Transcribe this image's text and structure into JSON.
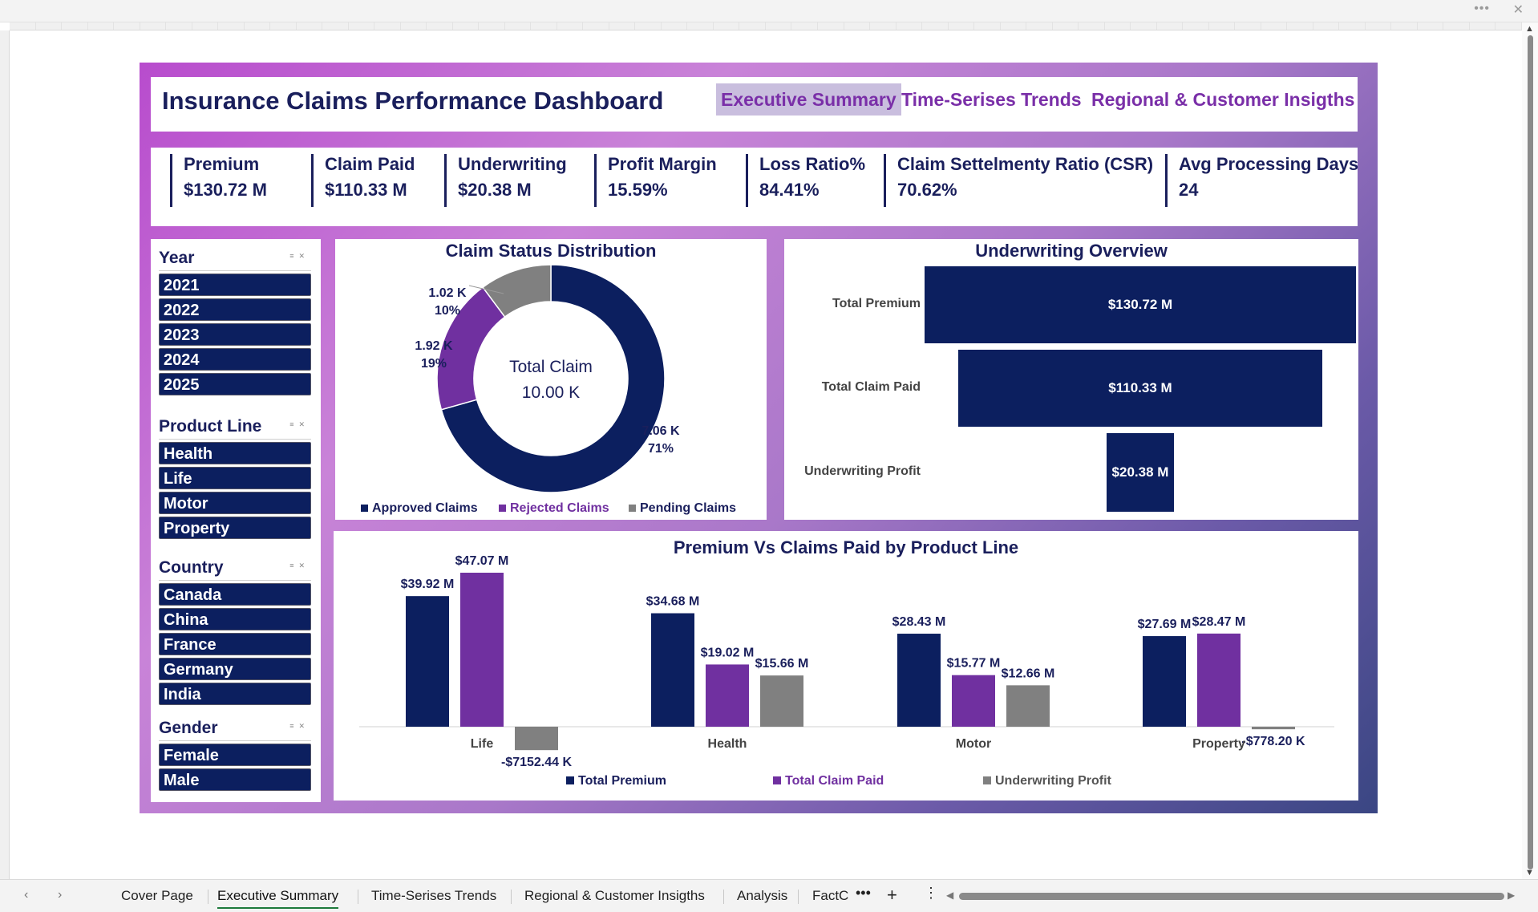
{
  "header": {
    "title": "Insurance Claims Performance Dashboard",
    "nav": [
      "Executive Summary",
      "Time-Serises Trends",
      "Regional & Customer Insigths"
    ]
  },
  "kpis": [
    {
      "label": "Premium",
      "value": "$130.72 M"
    },
    {
      "label": "Claim Paid",
      "value": "$110.33 M"
    },
    {
      "label": "Underwriting",
      "value": "$20.38 M"
    },
    {
      "label": "Profit Margin",
      "value": "15.59%"
    },
    {
      "label": "Loss Ratio%",
      "value": "84.41%"
    },
    {
      "label": "Claim Settelmenty Ratio (CSR)",
      "value": "70.62%"
    },
    {
      "label": "Avg Processing Days",
      "value": "24"
    }
  ],
  "slicers": {
    "year": {
      "title": "Year",
      "items": [
        "2021",
        "2022",
        "2023",
        "2024",
        "2025"
      ]
    },
    "product_line": {
      "title": "Product Line",
      "items": [
        "Health",
        "Life",
        "Motor",
        "Property"
      ]
    },
    "country": {
      "title": "Country",
      "items": [
        "Canada",
        "China",
        "France",
        "Germany",
        "India"
      ]
    },
    "gender": {
      "title": "Gender",
      "items": [
        "Female",
        "Male"
      ]
    }
  },
  "donut": {
    "title": "Claim Status Distribution",
    "center_label": "Total Claim",
    "center_value": "10.00 K",
    "slices": [
      {
        "name": "Approved Claims",
        "value": 7.06,
        "label": "7.06 K",
        "pct": "71%",
        "color": "#0c1f5f"
      },
      {
        "name": "Rejected Claims",
        "value": 1.92,
        "label": "1.92 K",
        "pct": "19%",
        "color": "#7030a0"
      },
      {
        "name": "Pending Claims",
        "value": 1.02,
        "label": "1.02 K",
        "pct": "10%",
        "color": "#808080"
      }
    ]
  },
  "underwriting": {
    "title": "Underwriting Overview",
    "rows": [
      {
        "label": "Total Premium",
        "value": 130.72,
        "text": "$130.72 M"
      },
      {
        "label": "Total Claim Paid",
        "value": 110.33,
        "text": "$110.33 M"
      },
      {
        "label": "Underwriting Profit",
        "value": 20.38,
        "text": "$20.38 M"
      }
    ]
  },
  "chart_data": {
    "type": "bar",
    "title": "Premium Vs Claims Paid by Product Line",
    "categories": [
      "Life",
      "Health",
      "Motor",
      "Property"
    ],
    "series": [
      {
        "name": "Total Premium",
        "color": "#0c1f5f",
        "values": [
          39.92,
          34.68,
          28.43,
          27.69
        ],
        "labels": [
          "$39.92 M",
          "$34.68 M",
          "$28.43 M",
          "$27.69 M"
        ]
      },
      {
        "name": "Total Claim Paid",
        "color": "#7030a0",
        "values": [
          47.07,
          19.02,
          15.77,
          28.47
        ],
        "labels": [
          "$47.07 M",
          "$19.02 M",
          "$15.77 M",
          "$28.47 M"
        ]
      },
      {
        "name": "Underwriting Profit",
        "color": "#808080",
        "values": [
          -7.15244,
          15.66,
          12.66,
          -0.7782
        ],
        "labels": [
          "-$7152.44 K",
          "$15.66 M",
          "$12.66 M",
          "-$778.20 K"
        ]
      }
    ]
  },
  "sheet_tabs": [
    "Cover Page",
    "Executive Summary",
    "Time-Serises Trends",
    "Regional & Customer Insigths",
    "Analysis",
    "FactC"
  ]
}
